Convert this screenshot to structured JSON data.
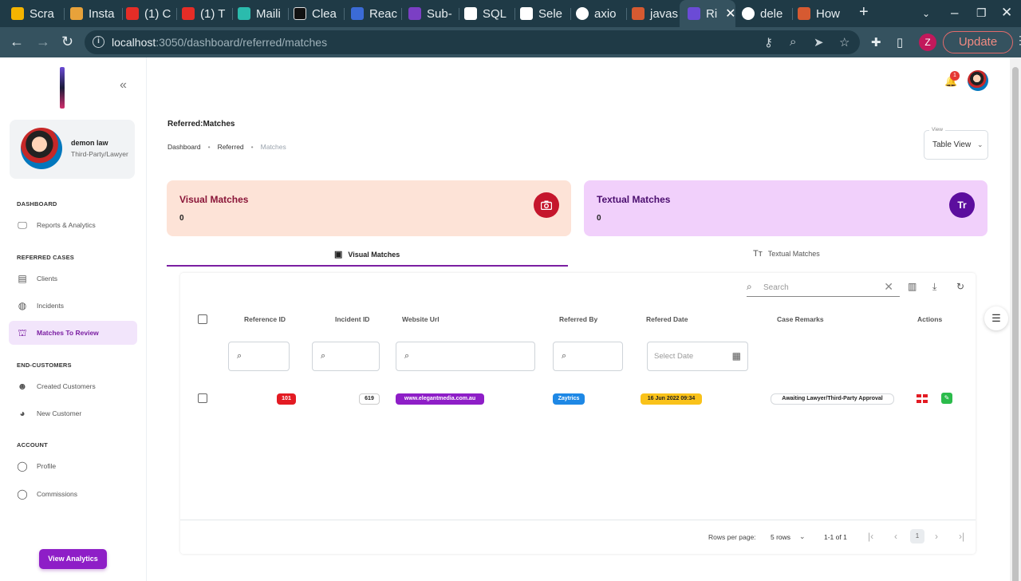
{
  "browser": {
    "tabs": [
      {
        "title": "Scra",
        "fav_color": "#f4b400"
      },
      {
        "title": "Insta",
        "fav_color": "#e8a23a"
      },
      {
        "title": "(1) C",
        "fav_color": "#e52d27"
      },
      {
        "title": "(1) T",
        "fav_color": "#e52d27"
      },
      {
        "title": "Maili",
        "fav_color": "#2bbbad"
      },
      {
        "title": "Clea",
        "fav_color": "#111111"
      },
      {
        "title": "Reac",
        "fav_color": "#3b6bd6"
      },
      {
        "title": "Sub-",
        "fav_color": "#7b3fc4"
      },
      {
        "title": "SQL",
        "fav_color": "#ffffff"
      },
      {
        "title": "Sele",
        "fav_color": "#ffffff"
      },
      {
        "title": "axio",
        "fav_color": "#ffffff"
      },
      {
        "title": "javas",
        "fav_color": "#d65a31"
      },
      {
        "title": "Ri",
        "fav_color": "#6b4bd6"
      },
      {
        "title": "dele",
        "fav_color": "#ffffff"
      },
      {
        "title": "How",
        "fav_color": "#d65a31"
      }
    ],
    "new_tab": "+",
    "url_host": "localhost",
    "url_path": ":3050/dashboard/referred/matches",
    "profile_initial": "Z",
    "update_label": "Update"
  },
  "sidebar": {
    "user": {
      "name": "demon law",
      "role": "Third-Party/Lawyer"
    },
    "sections": [
      {
        "title": "DASHBOARD",
        "items": [
          {
            "label": "Reports & Analytics",
            "icon": "monitor-icon",
            "active": false
          }
        ]
      },
      {
        "title": "REFERRED CASES",
        "items": [
          {
            "label": "Clients",
            "icon": "id-card-icon",
            "active": false
          },
          {
            "label": "Incidents",
            "icon": "incident-icon",
            "active": false
          },
          {
            "label": "Matches To Review",
            "icon": "matches-icon",
            "active": true
          }
        ]
      },
      {
        "title": "END-CUSTOMERS",
        "items": [
          {
            "label": "Created Customers",
            "icon": "customer-icon",
            "active": false
          },
          {
            "label": "New Customer",
            "icon": "add-customer-icon",
            "active": false
          }
        ]
      },
      {
        "title": "ACCOUNT",
        "items": [
          {
            "label": "Profile",
            "icon": "profile-icon",
            "active": false
          },
          {
            "label": "Commissions",
            "icon": "commission-icon",
            "active": false
          }
        ]
      }
    ],
    "view_analytics_label": "View Analytics"
  },
  "header": {
    "notification_count": "1"
  },
  "page": {
    "title": "Referred:Matches",
    "breadcrumbs": [
      "Dashboard",
      "Referred",
      "Matches"
    ],
    "view_select": {
      "legend": "View",
      "value": "Table View"
    }
  },
  "cards": {
    "visual": {
      "title": "Visual Matches",
      "count": "0",
      "color": "#fde3d7",
      "accent": "#c5162c"
    },
    "textual": {
      "title": "Textual Matches",
      "count": "0",
      "color": "#f1d0fb",
      "accent": "#5c0e9e",
      "icon_text": "Tr"
    }
  },
  "tabs": {
    "visual": "Visual Matches",
    "textual": "Textual Matches"
  },
  "table": {
    "search_placeholder": "Search",
    "columns": [
      "Reference ID",
      "Incident ID",
      "Website Url",
      "Referred By",
      "Refered Date",
      "Case Remarks",
      "Actions"
    ],
    "date_filter_placeholder": "Select Date",
    "rows": [
      {
        "reference_id": "101",
        "incident_id": "619",
        "website_url": "www.elegantmedia.com.au",
        "referred_by": "Zaytrics",
        "referred_date": "16 Jun 2022 09:34",
        "case_remarks": "Awaiting Lawyer/Third-Party Approval"
      }
    ],
    "footer": {
      "rows_per_page_label": "Rows per page:",
      "rows_per_page_value": "5 rows",
      "range": "1-1 of 1",
      "current_page": "1"
    }
  }
}
